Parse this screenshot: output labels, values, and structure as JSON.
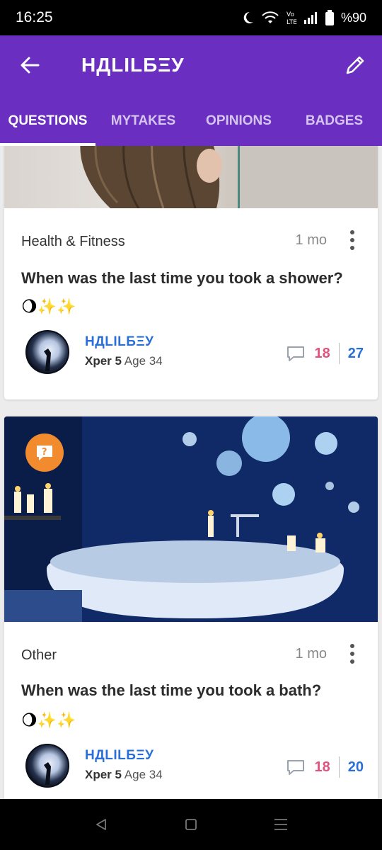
{
  "status_bar": {
    "time": "16:25",
    "battery": "%90",
    "icons": [
      "moon-icon",
      "wifi-icon",
      "volte-icon",
      "signal-icon",
      "battery-icon"
    ]
  },
  "header": {
    "title": "НДLILБΞУ",
    "back_icon": "arrow-left-icon",
    "edit_icon": "pencil-icon",
    "bg_color": "#6a2fc0"
  },
  "tabs": [
    {
      "label": "QUESTIONS",
      "active": true
    },
    {
      "label": "MYTAKES",
      "active": false
    },
    {
      "label": "OPINIONS",
      "active": false
    },
    {
      "label": "BADGES",
      "active": false
    }
  ],
  "posts": [
    {
      "category": "Health & Fitness",
      "time": "1 mo",
      "title": "When was the last time you took a shower?",
      "emoji": "🌖✨✨",
      "author": "НДLILБΞУ",
      "xper": "Xper 5",
      "age": "Age 34",
      "comments": "18",
      "votes": "27"
    },
    {
      "category": "Other",
      "time": "1 mo",
      "title": "When was the last time you took a bath?",
      "emoji": "🌖✨✨",
      "author": "НДLILБΞУ",
      "xper": "Xper 5",
      "age": "Age 34",
      "comments": "18",
      "votes": "20"
    }
  ],
  "colors": {
    "accent": "#6a2fc0",
    "author": "#2a6fd6",
    "comments": "#e0527e",
    "badge": "#f28a2e"
  }
}
